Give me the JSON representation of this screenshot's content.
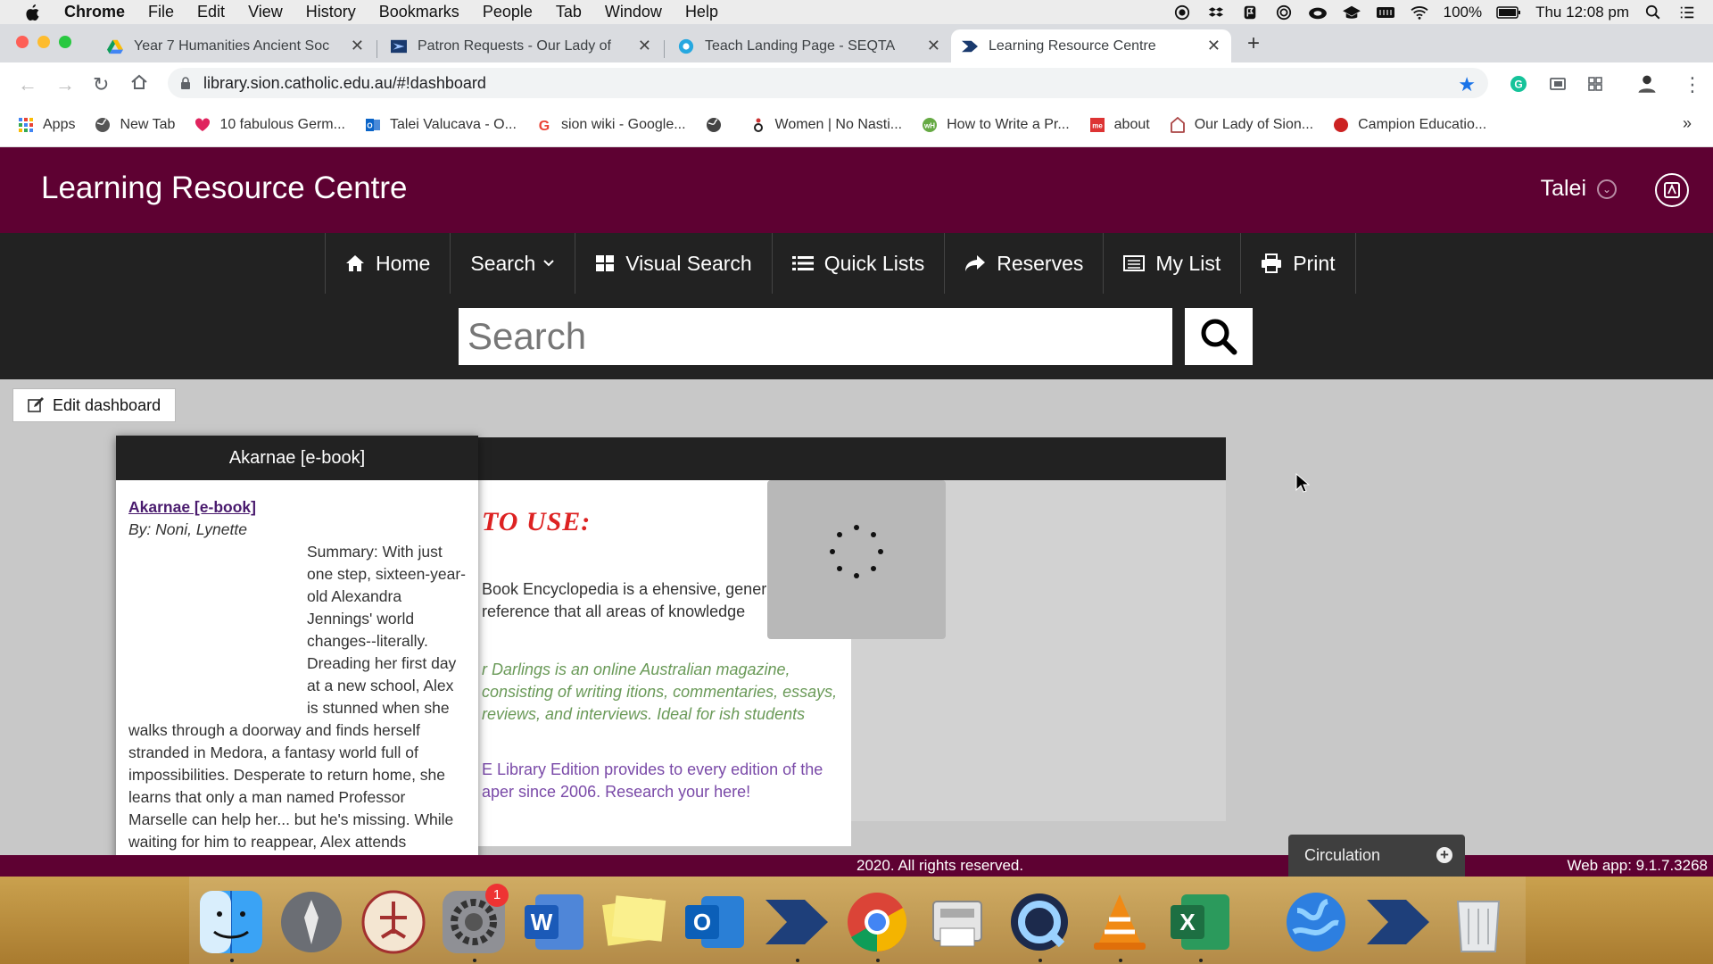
{
  "menubar": {
    "items": [
      "Chrome",
      "File",
      "Edit",
      "View",
      "History",
      "Bookmarks",
      "People",
      "Tab",
      "Window",
      "Help"
    ],
    "battery": "100%",
    "clock": "Thu 12:08 pm"
  },
  "tabs": [
    {
      "label": "Year 7 Humanities Ancient Soc",
      "color": "#fbbc04"
    },
    {
      "label": "Patron Requests - Our Lady of",
      "color": "#1a3a6e"
    },
    {
      "label": "Teach Landing Page - SEQTA",
      "color": "#26a8e0"
    },
    {
      "label": "Learning Resource Centre",
      "color": "#1a3a6e"
    }
  ],
  "address": {
    "url": "library.sion.catholic.edu.au/#!dashboard"
  },
  "bookmarks": [
    {
      "label": "Apps",
      "color": "#4285f4"
    },
    {
      "label": "New Tab",
      "color": "#555"
    },
    {
      "label": "10 fabulous Germ...",
      "color": "#e0245e"
    },
    {
      "label": "Talei Valucava - O...",
      "color": "#0a64c8"
    },
    {
      "label": "sion wiki - Google...",
      "color": "#ea4335"
    },
    {
      "label": "",
      "color": "#444"
    },
    {
      "label": "Women | No Nasti...",
      "color": "#c33"
    },
    {
      "label": "How to Write a Pr...",
      "color": "#6a4"
    },
    {
      "label": "about",
      "color": "#d33"
    },
    {
      "label": "Our Lady of Sion...",
      "color": "#a44"
    },
    {
      "label": "Campion Educatio...",
      "color": "#c22"
    }
  ],
  "header": {
    "title": "Learning Resource Centre",
    "user": "Talei"
  },
  "nav": {
    "home": "Home",
    "search": "Search",
    "visual_search": "Visual Search",
    "quick_lists": "Quick Lists",
    "reserves": "Reserves",
    "my_list": "My List",
    "print": "Print"
  },
  "search": {
    "placeholder": "Search"
  },
  "dashboard": {
    "edit_label": "Edit dashboard",
    "how_title": "TO  USE:",
    "p1": "Book Encyclopedia is a ehensive, general reference that all areas of knowledge",
    "p2": "r Darlings is an online Australian magazine, consisting of writing itions, commentaries, essays, reviews, and interviews. Ideal for ish students",
    "p3": "E Library Edition provides to every edition of the aper since 2006. Research your here!"
  },
  "popup": {
    "title": "Akarnae [e-book]",
    "link": "Akarnae [e-book]",
    "by": "By: Noni, Lynette",
    "summary": "Summary: With just one step, sixteen-year-old Alexandra Jennings' world changes--literally. Dreading her first day at a new school, Alex is stunned when she walks through a doorway and finds herself stranded in Medora, a fantasy world full of impossibilities. Desperate to return home, she learns that only a man named Professor Marselle can help her... but he's missing. While waiting for him to reappear, Alex attends Akarnae Academy, Medora's boarding school for"
  },
  "footer": {
    "copyright": "2020. All rights reserved.",
    "version": "Web app: 9.1.7.3268"
  },
  "circulation": {
    "label": "Circulation"
  },
  "dock": {
    "badge": "1"
  },
  "colors": {
    "brand": "#5e0132",
    "nav_bg": "#222222"
  }
}
